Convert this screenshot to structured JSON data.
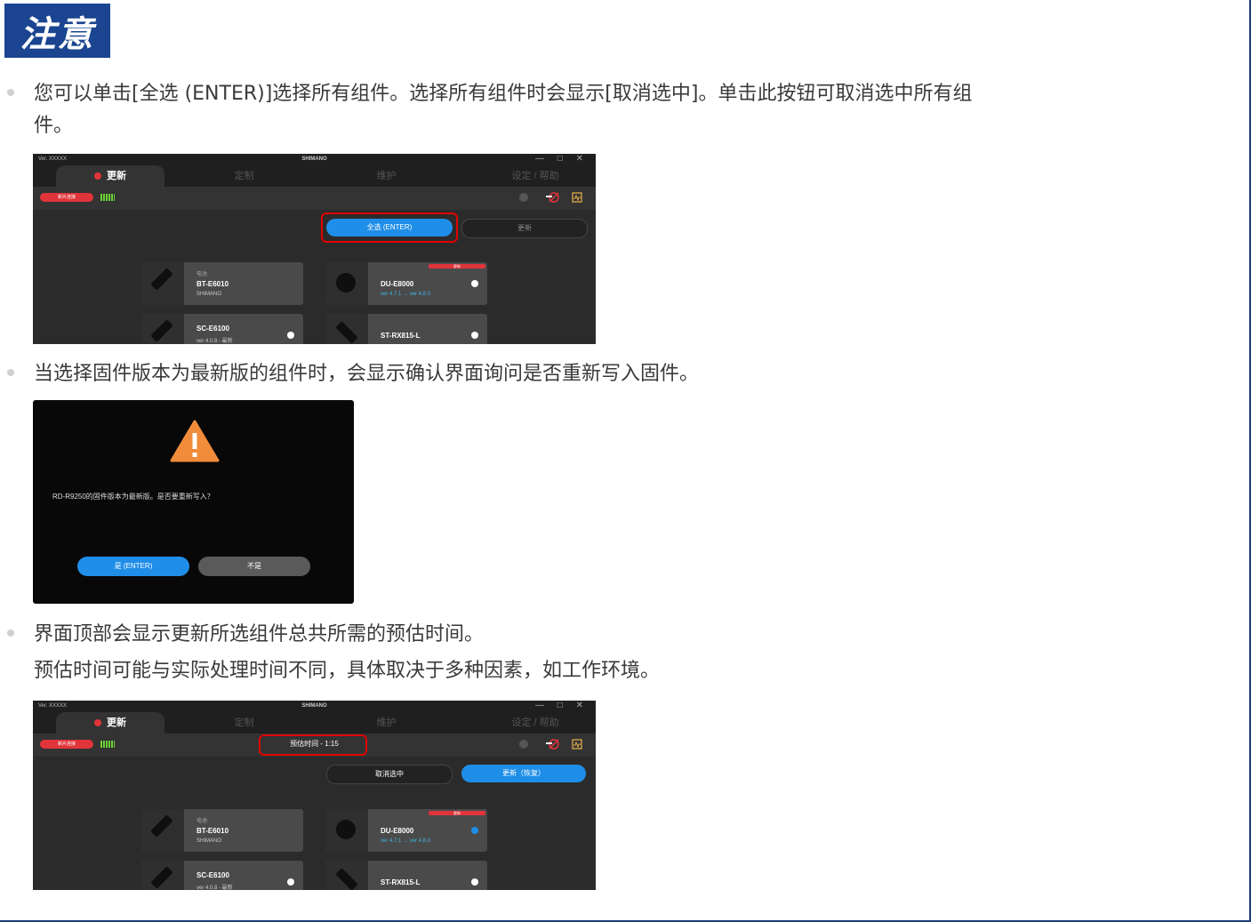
{
  "heading": "注意",
  "bullets": [
    "您可以单击[全选 (ENTER)]选择所有组件。选择所有组件时会显示[取消选中]。单击此按钮可取消选中所有组",
    "件。",
    "当选择固件版本为最新版的组件时，会显示确认界面询问是否重新写入固件。",
    "界面顶部会显示更新所选组件总共所需的预估时间。",
    "预估时间可能与实际处理时间不同，具体取决于多种因素，如工作环境。"
  ],
  "app": {
    "version": "Ver. XXXXX",
    "brand": "SHIMANO",
    "window_controls": "— □ ✕",
    "tabs": [
      "更新",
      "定制",
      "维护",
      "设定 / 帮助"
    ],
    "unit_pill": "新片连接",
    "colors": {
      "accent_blue": "#1f8ee8",
      "alert_red": "#e0343a",
      "highlight": "#e10000"
    }
  },
  "screen1": {
    "select_all_button": "全选 (ENTER)",
    "update_button": "更新"
  },
  "screen2": {
    "estimate_label": "预估时间 - 1:15",
    "deselect_button": "取消选中",
    "update_button": "更新（恢复）"
  },
  "cards": [
    {
      "category": "电池",
      "model": "BT-E6010",
      "sub": "SHIMANO"
    },
    {
      "category": "",
      "model": "DU-E8000",
      "sub": "ver 4.7.1 → ver 4.8.0",
      "flag": "更新"
    },
    {
      "category": "",
      "model": "SC-E6100",
      "sub": "ver 4.0.8 - 最新"
    },
    {
      "category": "",
      "model": "ST-RX815-L",
      "sub": ""
    }
  ],
  "dialog": {
    "message": "RD-R9250的固件版本为最新版。是否要重新写入？",
    "yes_button": "是 (ENTER)",
    "no_button": "不是",
    "warning_color": "#f08c3a"
  }
}
